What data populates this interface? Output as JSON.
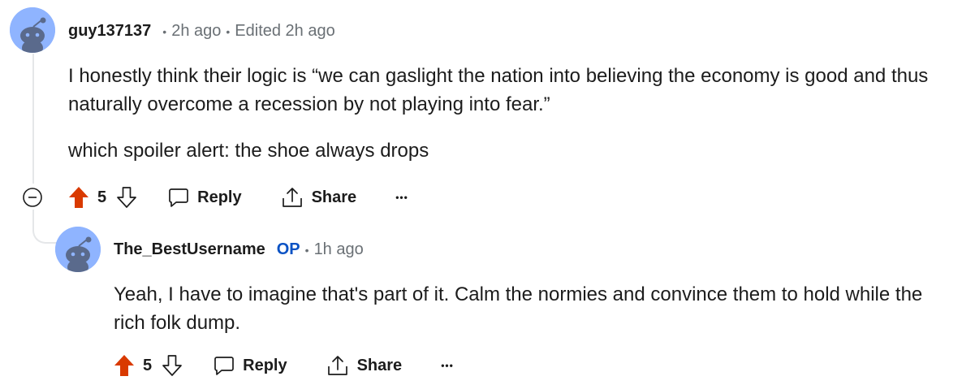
{
  "comment": {
    "author": "guy137137",
    "time": "2h ago",
    "edited": "Edited 2h ago",
    "paragraphs": [
      "I honestly think their logic is “we can gaslight the nation into believing the economy is good and thus naturally overcome a recession by not playing into fear.”",
      "which spoiler alert: the shoe always drops"
    ],
    "score": "5",
    "reply_label": "Reply",
    "share_label": "Share",
    "more_label": "•••"
  },
  "reply": {
    "author": "The_BestUsername",
    "op_badge": "OP",
    "time": "1h ago",
    "paragraphs": [
      "Yeah, I have to imagine that's part of it. Calm the normies and convince them to hold while the rich folk dump."
    ],
    "score": "5",
    "reply_label": "Reply",
    "share_label": "Share",
    "more_label": "•••"
  },
  "colors": {
    "upvote_active": "#d93a00",
    "op_badge": "#0a52c4",
    "muted": "#6a7075",
    "avatar_bg": "#8fb4ff",
    "thread_line": "#e5e7e9"
  },
  "icons": [
    "snoo-avatar-icon",
    "collapse-icon",
    "upvote-icon",
    "downvote-icon",
    "comment-icon",
    "share-icon",
    "more-icon"
  ]
}
